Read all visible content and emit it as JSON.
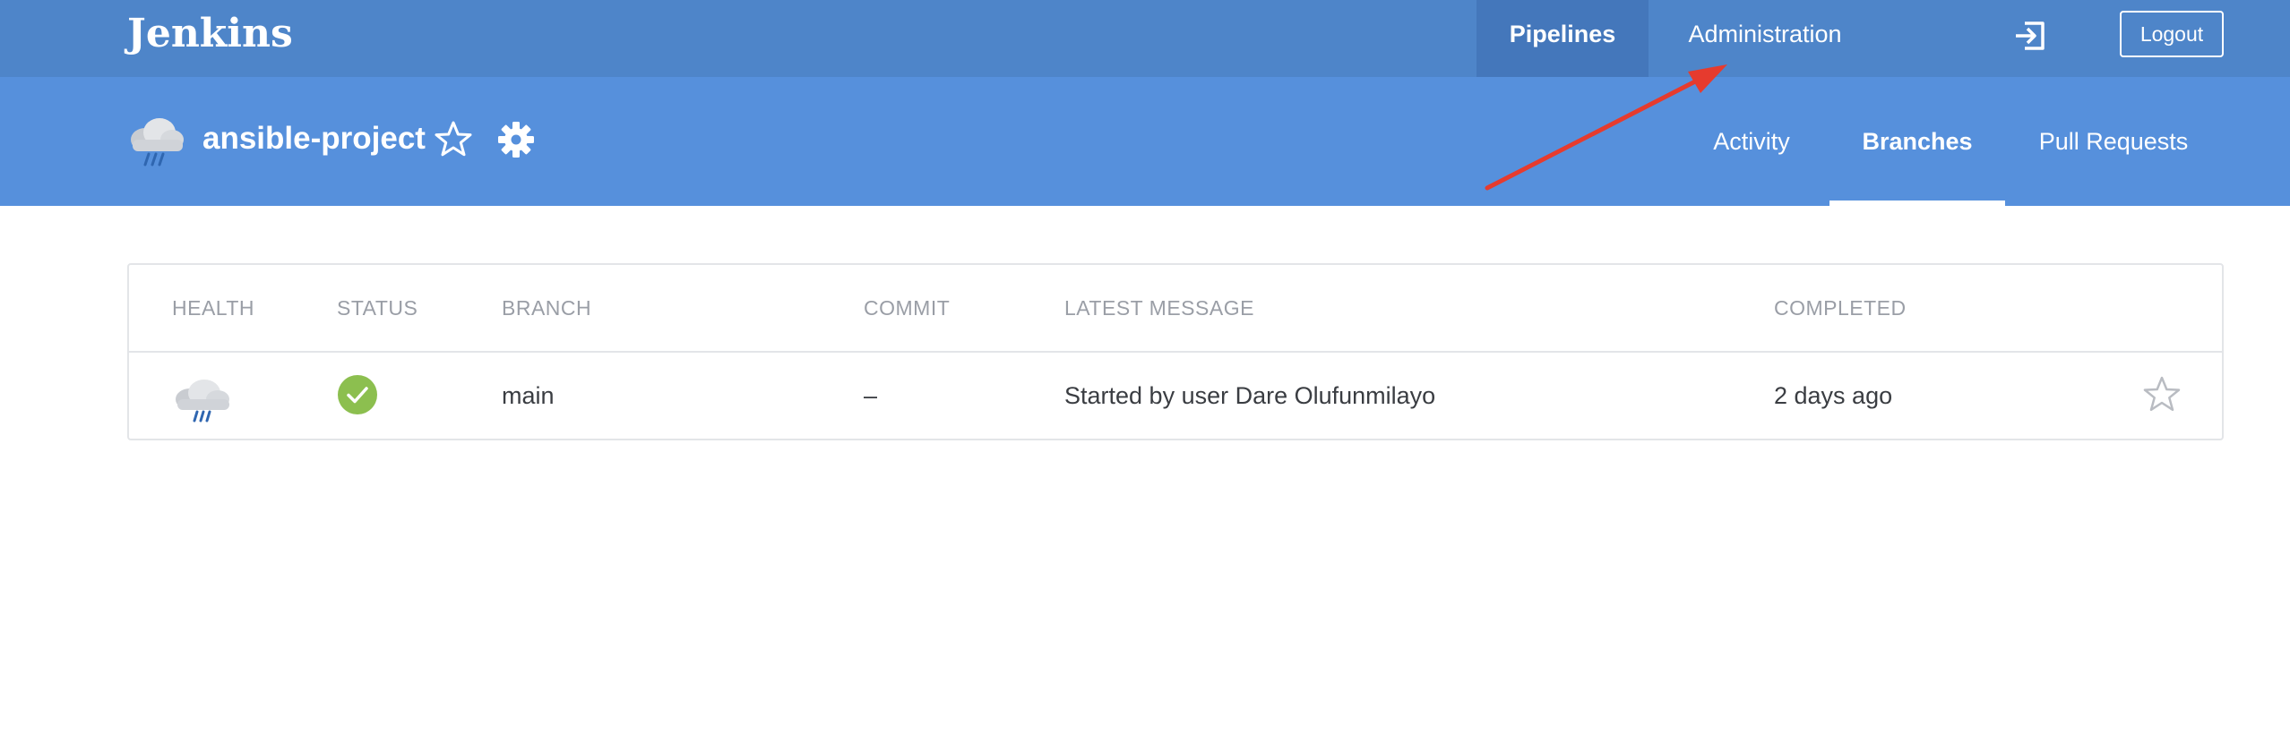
{
  "app": {
    "logo": "Jenkins"
  },
  "topnav": {
    "pipelines": "Pipelines",
    "administration": "Administration",
    "logout": "Logout"
  },
  "project": {
    "name": "ansible-project",
    "tabs": {
      "activity": "Activity",
      "branches": "Branches",
      "pull_requests": "Pull Requests"
    }
  },
  "table": {
    "headers": {
      "health": "HEALTH",
      "status": "STATUS",
      "branch": "BRANCH",
      "commit": "COMMIT",
      "latest_message": "LATEST MESSAGE",
      "completed": "COMPLETED"
    },
    "rows": [
      {
        "health": "rain-cloud-icon",
        "status": "success",
        "branch": "main",
        "commit": "–",
        "latest_message": "Started by user Dare Olufunmilayo",
        "completed": "2 days ago"
      }
    ]
  },
  "icons": {
    "project_health": "rain-cloud-icon",
    "favorite": "star-outline-icon",
    "settings": "gear-icon",
    "exit": "exit-icon",
    "status_success": "check-circle-icon",
    "annotation": "red-arrow-annotation"
  },
  "colors": {
    "topbar": "#4e85c9",
    "topbar_active": "#4477bb",
    "project_bar": "#5690dc",
    "success": "#8cbf4f",
    "annotation_arrow": "#e63b2e",
    "header_text": "#9a9ea6",
    "body_text": "#3a3d42"
  }
}
